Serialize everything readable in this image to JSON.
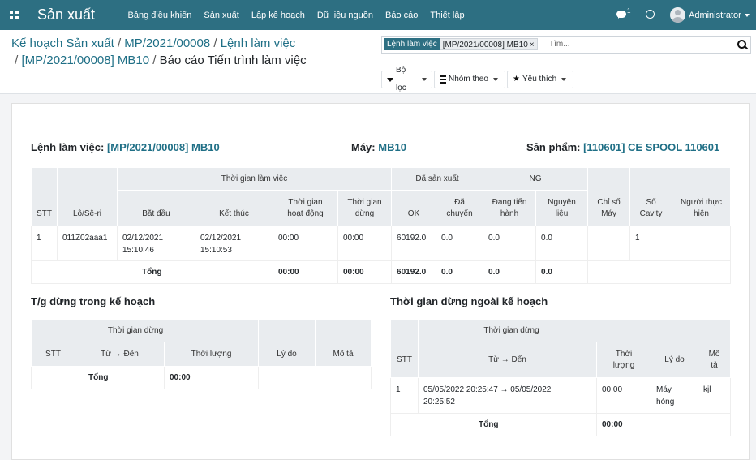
{
  "navbar": {
    "app_title": "Sản xuất",
    "menu": [
      "Bảng điều khiển",
      "Sản xuất",
      "Lập kế hoạch",
      "Dữ liệu nguồn",
      "Báo cáo",
      "Thiết lập"
    ],
    "chat_count": "1",
    "user": "Administrator"
  },
  "breadcrumb": {
    "items": [
      "Kế hoạch Sản xuất",
      "MP/2021/00008",
      "Lệnh làm việc",
      "[MP/2021/00008] MB10"
    ],
    "current": "Báo cáo Tiến trình làm việc"
  },
  "search": {
    "facet_label": "Lệnh làm việc",
    "facet_value": "[MP/2021/00008] MB10",
    "placeholder": "Tìm..."
  },
  "filters": {
    "filter": "Bộ lọc",
    "group_by": "Nhóm theo",
    "favorites": "Yêu thích"
  },
  "report": {
    "workorder_label": "Lệnh làm việc:",
    "workorder_value": "[MP/2021/00008] MB10",
    "machine_label": "Máy:",
    "machine_value": "MB10",
    "product_label": "Sản phẩm:",
    "product_value": "[110601] CE SPOOL 110601",
    "main": {
      "groups": {
        "time": "Thời gian làm việc",
        "produced": "Đã sản xuất",
        "ng": "NG"
      },
      "headers": {
        "stt": "STT",
        "lot": "Lô/Sê-ri",
        "start": "Bắt đầu",
        "end": "Kết thúc",
        "op_time_1": "Thời gian",
        "op_time_2": "hoạt động",
        "stop_time_1": "Thời gian",
        "stop_time_2": "dừng",
        "ok": "OK",
        "moved_1": "Đã",
        "moved_2": "chuyển",
        "wip_1": "Đang tiến",
        "wip_2": "hành",
        "material_1": "Nguyên",
        "material_2": "liệu",
        "counter_1": "Chỉ số",
        "counter_2": "Máy",
        "cavity_1": "Số",
        "cavity_2": "Cavity",
        "operator_1": "Người thực",
        "operator_2": "hiện"
      },
      "row": {
        "stt": "1",
        "lot": "011Z02aaa1",
        "start_date": "02/12/2021",
        "start_time": "15:10:46",
        "end_date": "02/12/2021",
        "end_time": "15:10:53",
        "op_time": "00:00",
        "stop_time": "00:00",
        "ok": "60192.0",
        "moved": "0.0",
        "wip": "0.0",
        "material": "0.0",
        "counter": "",
        "cavity": "1",
        "operator": ""
      },
      "total": {
        "label": "Tổng",
        "op_time": "00:00",
        "stop_time": "00:00",
        "ok": "60192.0",
        "moved": "0.0",
        "wip": "0.0",
        "material": "0.0"
      }
    },
    "planned_stop": {
      "title": "T/g dừng trong kế hoạch",
      "group": "Thời gian dừng",
      "headers": {
        "stt": "STT",
        "range": "Từ → Đến",
        "duration": "Thời lượng",
        "reason": "Lý do",
        "desc": "Mô tả"
      },
      "total_label": "Tổng",
      "total_duration": "00:00"
    },
    "unplanned_stop": {
      "title": "Thời gian dừng ngoài kế hoạch",
      "group": "Thời gian dừng",
      "headers": {
        "stt": "STT",
        "range": "Từ → Đến",
        "duration_1": "Thời",
        "duration_2": "lượng",
        "reason": "Lý do",
        "desc_1": "Mô",
        "desc_2": "tả"
      },
      "row": {
        "stt": "1",
        "range_1": "05/05/2022 20:25:47 → 05/05/2022",
        "range_2": "20:25:52",
        "duration": "00:00",
        "reason_1": "Máy",
        "reason_2": "hỏng",
        "desc": "kjl"
      },
      "total_label": "Tổng",
      "total_duration": "00:00"
    }
  }
}
